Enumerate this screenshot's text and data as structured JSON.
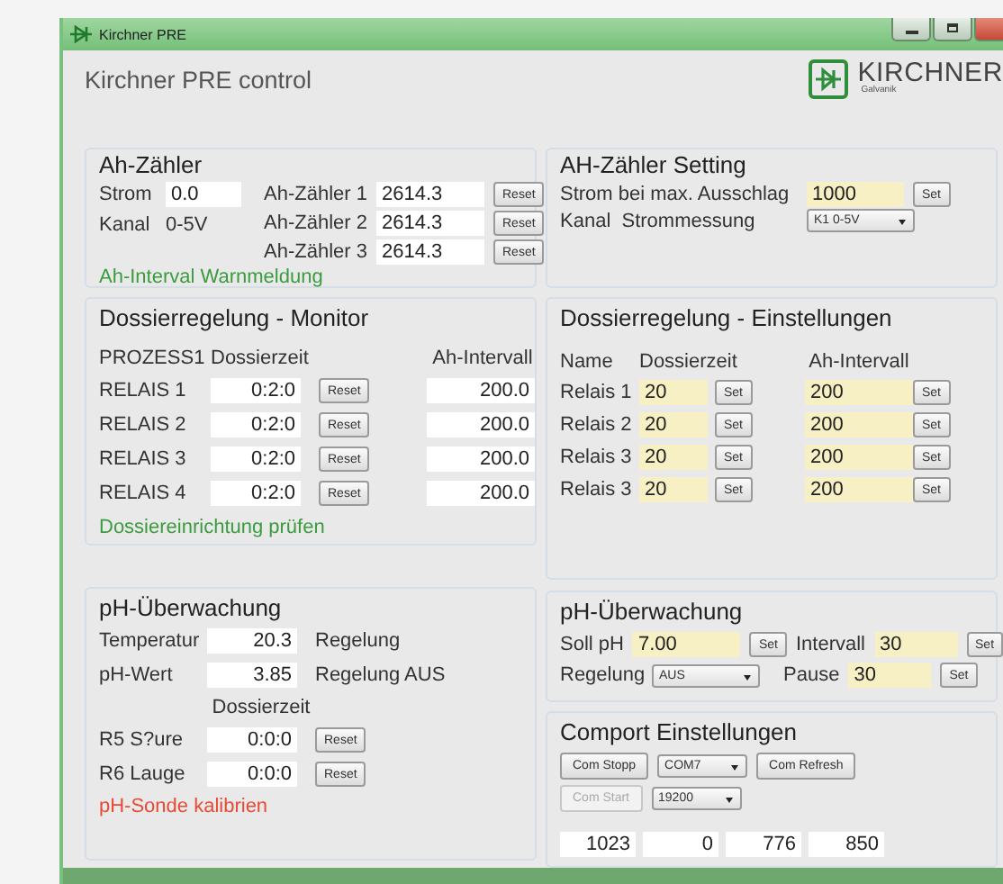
{
  "window": {
    "title": "Kirchner PRE"
  },
  "header": {
    "title": "Kirchner PRE control",
    "logo_text": "KIRCHNER",
    "logo_subtext": "Galvanik"
  },
  "ah_counter": {
    "title": "Ah-Zähler",
    "current_label": "Strom",
    "current_value": "0.0",
    "channel_label": "Kanal",
    "channel_value": "0-5V",
    "counters": [
      {
        "label": "Ah-Zähler 1",
        "value": "2614.3",
        "button": "Reset"
      },
      {
        "label": "Ah-Zähler 2",
        "value": "2614.3",
        "button": "Reset"
      },
      {
        "label": "Ah-Zähler 3",
        "value": "2614.3",
        "button": "Reset"
      }
    ],
    "note": "Ah-Interval Warnmeldung"
  },
  "ah_setting": {
    "title": "AH-Zähler Setting",
    "current_label": "Strom bei max. Ausschlag",
    "current_value": "1000",
    "set_button": "Set",
    "channel_label": "Kanal  Strommessung",
    "channel_select": "K1 0-5V"
  },
  "dosing_monitor": {
    "title": "Dossierregelung - Monitor",
    "columns": [
      "PROZESS1",
      "Dossierzeit",
      "Ah-Intervall"
    ],
    "rows": [
      {
        "name": "RELAIS 1",
        "time": "0:2:0",
        "button": "Reset",
        "interval": "200.0"
      },
      {
        "name": "RELAIS 2",
        "time": "0:2:0",
        "button": "Reset",
        "interval": "200.0"
      },
      {
        "name": "RELAIS 3",
        "time": "0:2:0",
        "button": "Reset",
        "interval": "200.0"
      },
      {
        "name": "RELAIS 4",
        "time": "0:2:0",
        "button": "Reset",
        "interval": "200.0"
      }
    ],
    "note": "Dossiereinrichtung prüfen"
  },
  "dosing_settings": {
    "title": "Dossierregelung - Einstellungen",
    "columns": [
      "Name",
      "Dossierzeit",
      "Ah-Intervall"
    ],
    "rows": [
      {
        "name": "Relais 1",
        "time": "20",
        "time_button": "Set",
        "interval": "200",
        "interval_button": "Set"
      },
      {
        "name": "Relais 2",
        "time": "20",
        "time_button": "Set",
        "interval": "200",
        "interval_button": "Set"
      },
      {
        "name": "Relais 3",
        "time": "20",
        "time_button": "Set",
        "interval": "200",
        "interval_button": "Set"
      },
      {
        "name": "Relais 3",
        "time": "20",
        "time_button": "Set",
        "interval": "200",
        "interval_button": "Set"
      }
    ]
  },
  "ph_monitor": {
    "title": "pH-Überwachung",
    "temperature_label": "Temperatur",
    "temperature": "20.3",
    "control_label": "Regelung",
    "ph_label": "pH-Wert",
    "ph": "3.85",
    "control_status": "Regelung AUS",
    "time_heading": "Dossierzeit",
    "rows": [
      {
        "name": "R5 S?ure",
        "time": "0:0:0",
        "button": "Reset"
      },
      {
        "name": "R6 Lauge",
        "time": "0:0:0",
        "button": "Reset"
      }
    ],
    "note": "pH-Sonde kalibrien"
  },
  "ph_settings": {
    "title": "pH-Überwachung",
    "setpoint_label": "Soll pH",
    "setpoint": "7.00",
    "setpoint_button": "Set",
    "interval_label": "Intervall",
    "interval": "30",
    "interval_button": "Set",
    "control_label": "Regelung",
    "control_select": "AUS",
    "pause_label": "Pause",
    "pause": "30",
    "pause_button": "Set"
  },
  "comport": {
    "title": "Comport Einstellungen",
    "rows": [
      [
        {
          "kind": "button",
          "label": "Com Stopp",
          "disabled": false
        },
        {
          "kind": "select",
          "value": "COM7"
        },
        {
          "kind": "button",
          "label": "Com Refresh",
          "disabled": false
        }
      ],
      [
        {
          "kind": "button",
          "label": "Com Start",
          "disabled": true
        },
        {
          "kind": "select",
          "value": "19200"
        }
      ]
    ],
    "readings": [
      "1023",
      "0",
      "776",
      "850"
    ]
  }
}
